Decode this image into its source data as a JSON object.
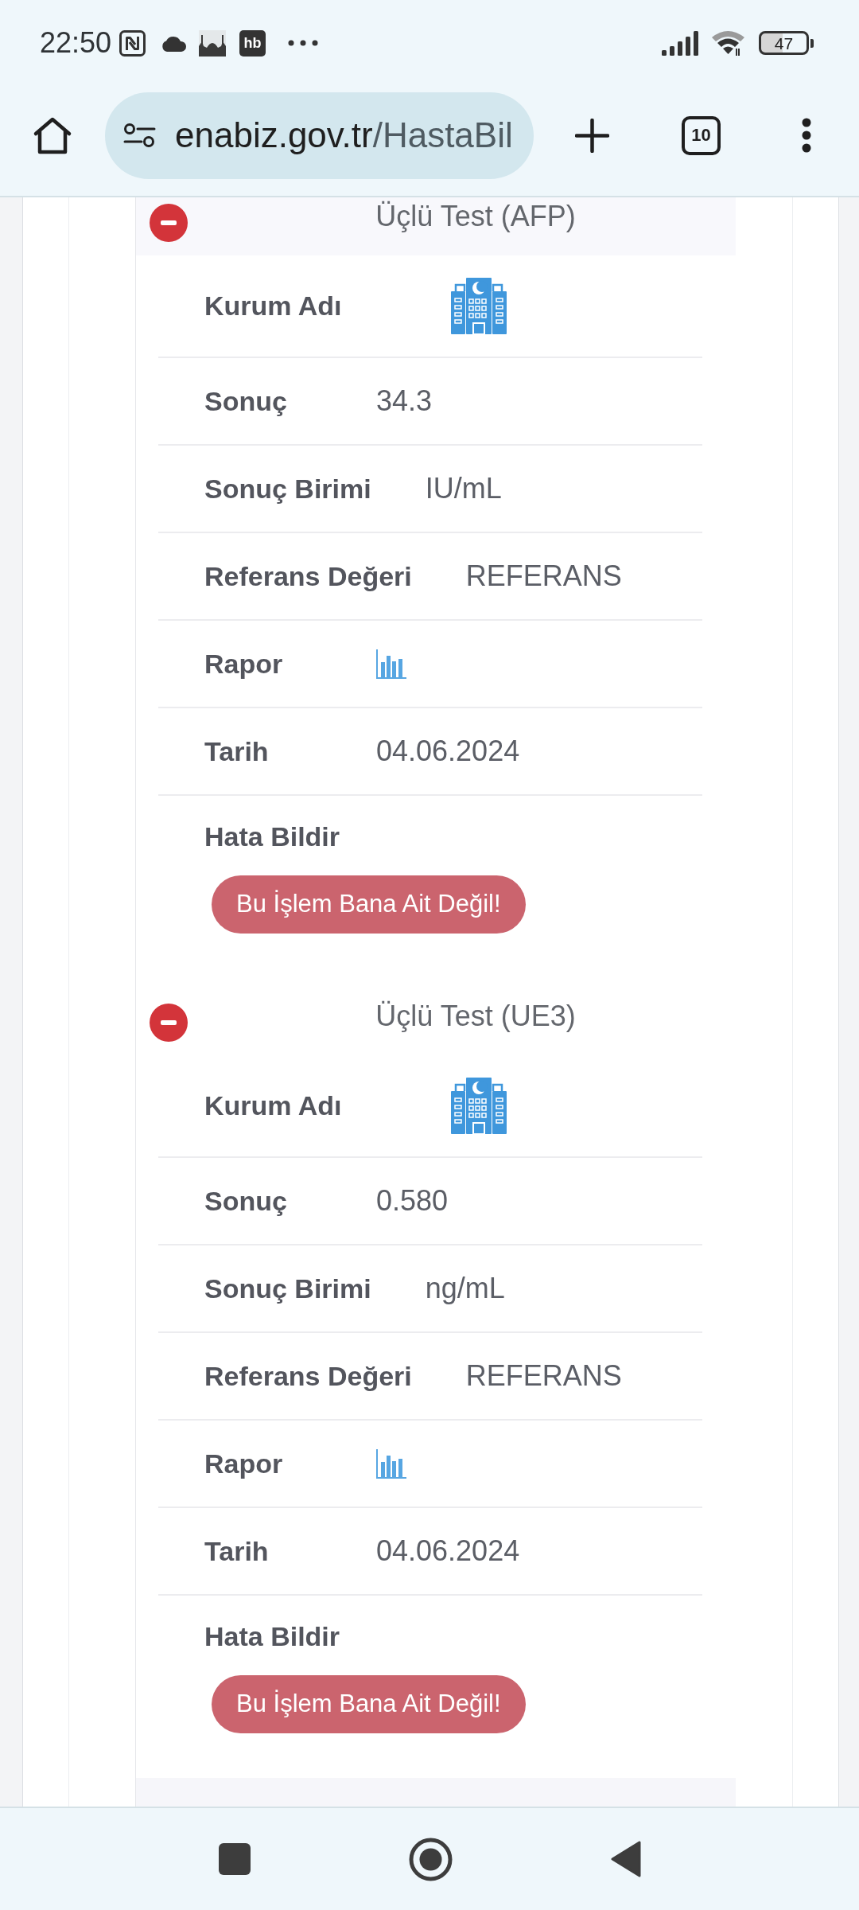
{
  "status_bar": {
    "time": "22:50",
    "app_badge": "hb",
    "battery": "47"
  },
  "browser_toolbar": {
    "url_host": "enabiz.gov.tr",
    "url_path": "/HastaBil",
    "tab_count": "10"
  },
  "tests": [
    {
      "title": "Üçlü Test (AFP)",
      "expanded": true,
      "fields": [
        {
          "kind": "institution",
          "label": "Kurum Adı"
        },
        {
          "kind": "text",
          "label": "Sonuç",
          "value": "34.3"
        },
        {
          "kind": "text",
          "label": "Sonuç Birimi",
          "value": "IU/mL"
        },
        {
          "kind": "text",
          "label": "Referans Değeri",
          "value": "REFERANS"
        },
        {
          "kind": "report",
          "label": "Rapor"
        },
        {
          "kind": "text",
          "label": "Tarih",
          "value": "04.06.2024"
        }
      ],
      "error_report": {
        "label": "Hata Bildir",
        "button": "Bu İşlem Bana Ait Değil!"
      }
    },
    {
      "title": "Üçlü Test (UE3)",
      "expanded": true,
      "fields": [
        {
          "kind": "institution",
          "label": "Kurum Adı"
        },
        {
          "kind": "text",
          "label": "Sonuç",
          "value": "0.580"
        },
        {
          "kind": "text",
          "label": "Sonuç Birimi",
          "value": "ng/mL"
        },
        {
          "kind": "text",
          "label": "Referans Değeri",
          "value": "REFERANS"
        },
        {
          "kind": "report",
          "label": "Rapor"
        },
        {
          "kind": "text",
          "label": "Tarih",
          "value": "04.06.2024"
        }
      ],
      "error_report": {
        "label": "Hata Bildir",
        "button": "Bu İşlem Bana Ait Değil!"
      }
    }
  ]
}
